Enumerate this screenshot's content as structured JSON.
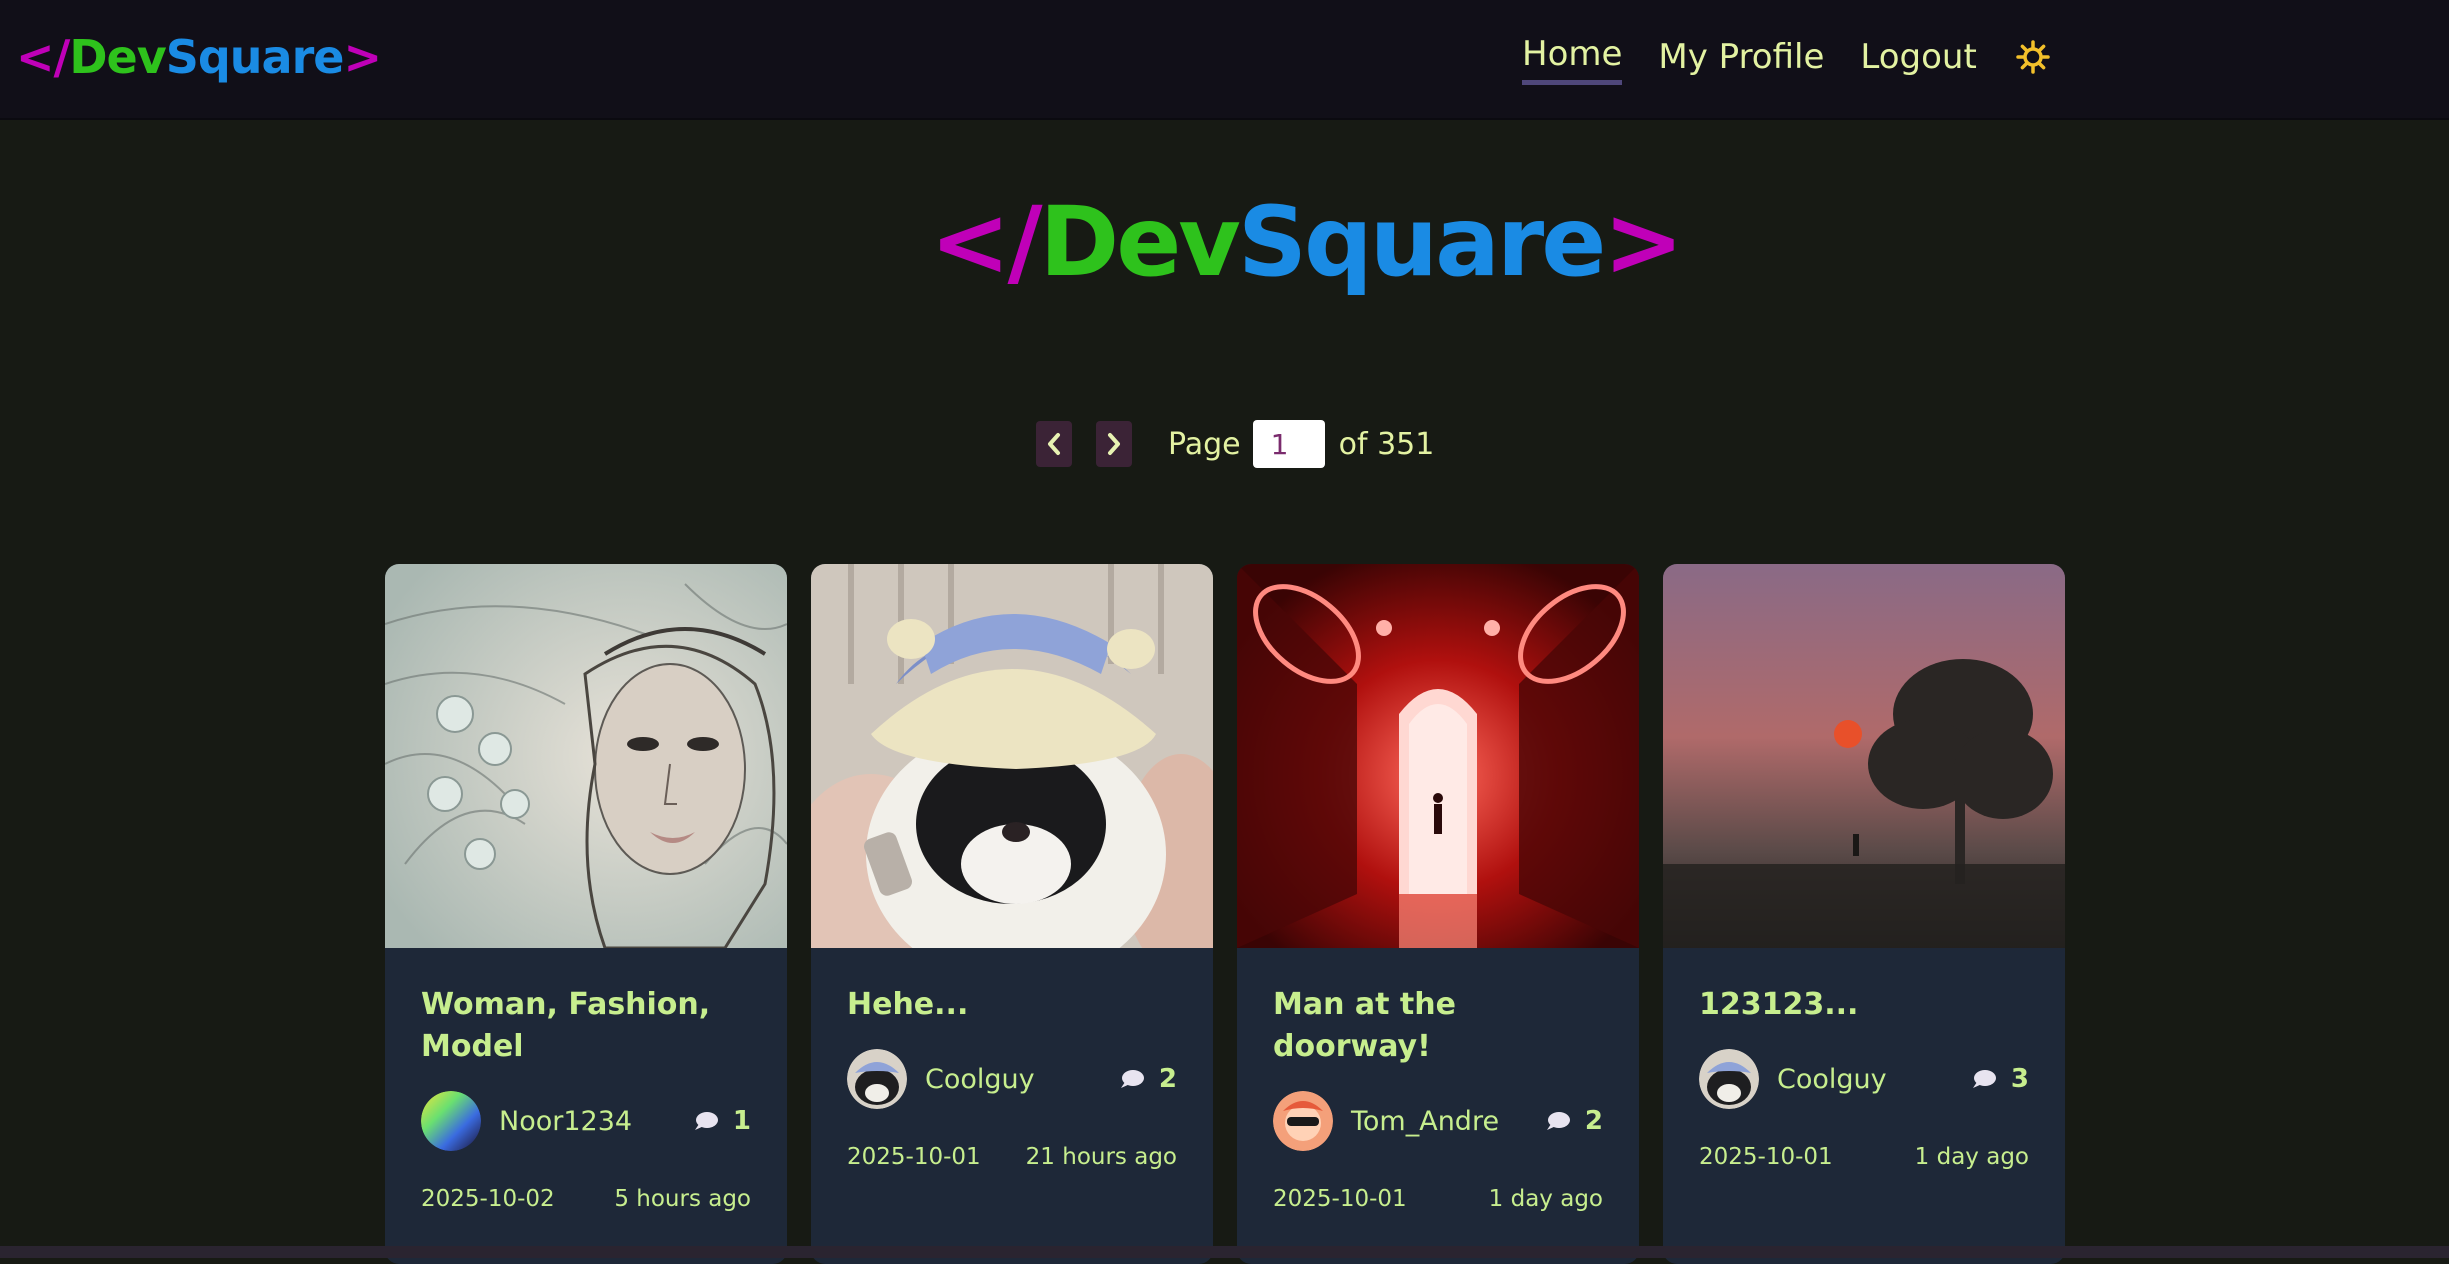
{
  "nav": {
    "logo": {
      "open": "</",
      "dev": "Dev",
      "square": "Square",
      "close": ">"
    },
    "links": [
      {
        "label": "Home",
        "active": true
      },
      {
        "label": "My Profile",
        "active": false
      },
      {
        "label": "Logout",
        "active": false
      }
    ],
    "theme_icon": "sun-icon"
  },
  "hero": {
    "logo": {
      "open": "</",
      "dev": "Dev",
      "square": "Square",
      "close": ">"
    }
  },
  "pagination": {
    "prev_icon": "chevron-left-icon",
    "next_icon": "chevron-right-icon",
    "page_label": "Page",
    "current_page": "1",
    "of_label": "of 351"
  },
  "posts": [
    {
      "title": "Woman, Fashion, Model",
      "author": "Noor1234",
      "comments": "1",
      "date": "2025-10-02",
      "relative": "5 hours ago"
    },
    {
      "title": "Hehe...",
      "author": "Coolguy",
      "comments": "2",
      "date": "2025-10-01",
      "relative": "21 hours ago"
    },
    {
      "title": "Man at the doorway!",
      "author": "Tom_Andre",
      "comments": "2",
      "date": "2025-10-01",
      "relative": "1 day ago"
    },
    {
      "title": "123123...",
      "author": "Coolguy",
      "comments": "3",
      "date": "2025-10-01",
      "relative": "1 day ago"
    }
  ],
  "colors": {
    "background": "#171a14",
    "navbar": "#110f18",
    "card": "#1e2838",
    "accent_text": "#c7ee8e",
    "nav_text": "#e3f2a2",
    "logo_bracket": "#c000b8",
    "logo_dev": "#2ec21c",
    "logo_square": "#1a8be4"
  }
}
